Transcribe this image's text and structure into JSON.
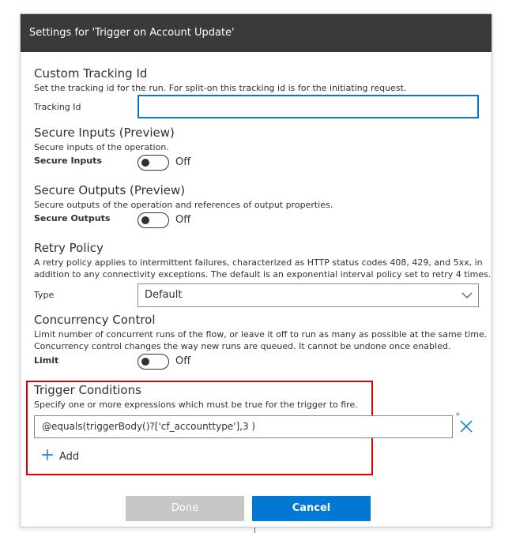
{
  "header": {
    "title": "Settings for 'Trigger on Account Update'"
  },
  "tracking": {
    "title": "Custom Tracking Id",
    "description": "Set the tracking id for the run. For split-on this tracking id is for the initiating request.",
    "label": "Tracking Id",
    "value": ""
  },
  "secure_inputs": {
    "title": "Secure Inputs (Preview)",
    "description": "Secure inputs of the operation.",
    "label": "Secure Inputs",
    "state": "Off"
  },
  "secure_outputs": {
    "title": "Secure Outputs (Preview)",
    "description": "Secure outputs of the operation and references of output properties.",
    "label": "Secure Outputs",
    "state": "Off"
  },
  "retry": {
    "title": "Retry Policy",
    "description_line1": "A retry policy applies to intermittent failures, characterized as HTTP status codes 408, 429, and 5xx, in",
    "description_line2": "addition to any connectivity exceptions. The default is an exponential interval policy set to retry 4 times.",
    "label": "Type",
    "selected": "Default"
  },
  "concurrency": {
    "title": "Concurrency Control",
    "description_line1": "Limit number of concurrent runs of the flow, or leave it off to run as many as possible at the same time.",
    "description_line2": "Concurrency control changes the way new runs are queued. It cannot be undone once enabled.",
    "label": "Limit",
    "state": "Off"
  },
  "trigger_conditions": {
    "title": "Trigger Conditions",
    "description": "Specify one or more expressions which must be true for the trigger to fire.",
    "condition": "@equals(triggerBody()?['cf_accounttype'],3 )",
    "required_mark": "*",
    "add_label": "Add"
  },
  "footer": {
    "done_label": "Done",
    "cancel_label": "Cancel"
  },
  "colors": {
    "header_bg": "#3b3a39",
    "accent": "#0078d4",
    "highlight": "#e00000",
    "disabled": "#c8c6c4"
  },
  "icons": {
    "toggle": "toggle-off",
    "dropdown": "chevron-down-icon",
    "remove": "close-icon",
    "add": "plus-icon"
  }
}
